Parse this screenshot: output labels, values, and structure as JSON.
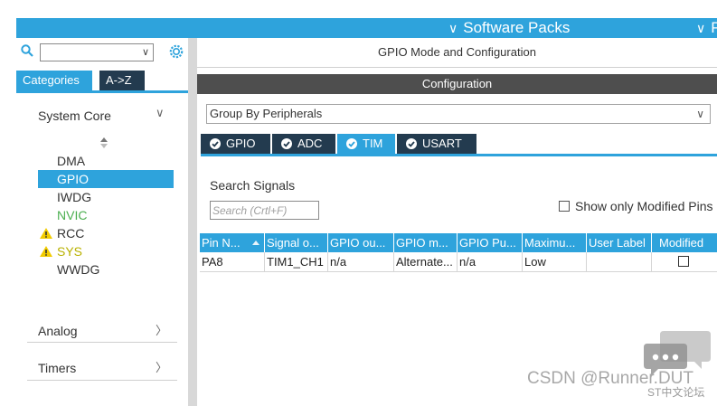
{
  "topbar": {
    "software_packs": "Software Packs",
    "next": "Pi"
  },
  "left": {
    "search": {
      "value": "",
      "placeholder": ""
    },
    "tabs": [
      "Categories",
      "A->Z"
    ],
    "system_core": {
      "title": "System Core",
      "items": [
        {
          "label": "DMA",
          "state": "normal"
        },
        {
          "label": "GPIO",
          "state": "selected"
        },
        {
          "label": "IWDG",
          "state": "normal"
        },
        {
          "label": "NVIC",
          "state": "green"
        },
        {
          "label": "RCC",
          "state": "warning"
        },
        {
          "label": "SYS",
          "state": "warning"
        },
        {
          "label": "WWDG",
          "state": "normal"
        }
      ]
    },
    "analog": {
      "title": "Analog"
    },
    "timers": {
      "title": "Timers"
    }
  },
  "right": {
    "mode_header": "GPIO Mode and Configuration",
    "configuration": "Configuration",
    "group_by": "Group By Peripherals",
    "tabs": [
      "GPIO",
      "ADC",
      "TIM",
      "USART"
    ],
    "active_tab": "TIM",
    "search_signals_label": "Search Signals",
    "search_placeholder": "Search (Crtl+F)",
    "show_modified": "Show only Modified Pins",
    "table": {
      "headers": [
        "Pin N...",
        "Signal o...",
        "GPIO ou...",
        "GPIO m...",
        "GPIO Pu...",
        "Maximu...",
        "User Label",
        "Modified"
      ],
      "rows": [
        {
          "pin": "PA8",
          "signal": "TIM1_CH1",
          "gpio_output": "n/a",
          "gpio_mode": "Alternate...",
          "gpio_pull": "n/a",
          "max_speed": "Low",
          "user_label": "",
          "modified": false
        }
      ]
    }
  },
  "watermark": {
    "text": "CSDN @Runner.DUT",
    "sub": "ST中文论坛"
  },
  "colors": {
    "accent": "#2ea3dc",
    "dark_tab": "#233b4f",
    "config_bar": "#4e4e4e",
    "nvic_green": "#4caf50",
    "warning": "#f2cc00"
  },
  "icons": {
    "search": "search-icon",
    "settings": "gear-icon",
    "warning": "warning-triangle-icon",
    "check": "check-circle-icon"
  }
}
